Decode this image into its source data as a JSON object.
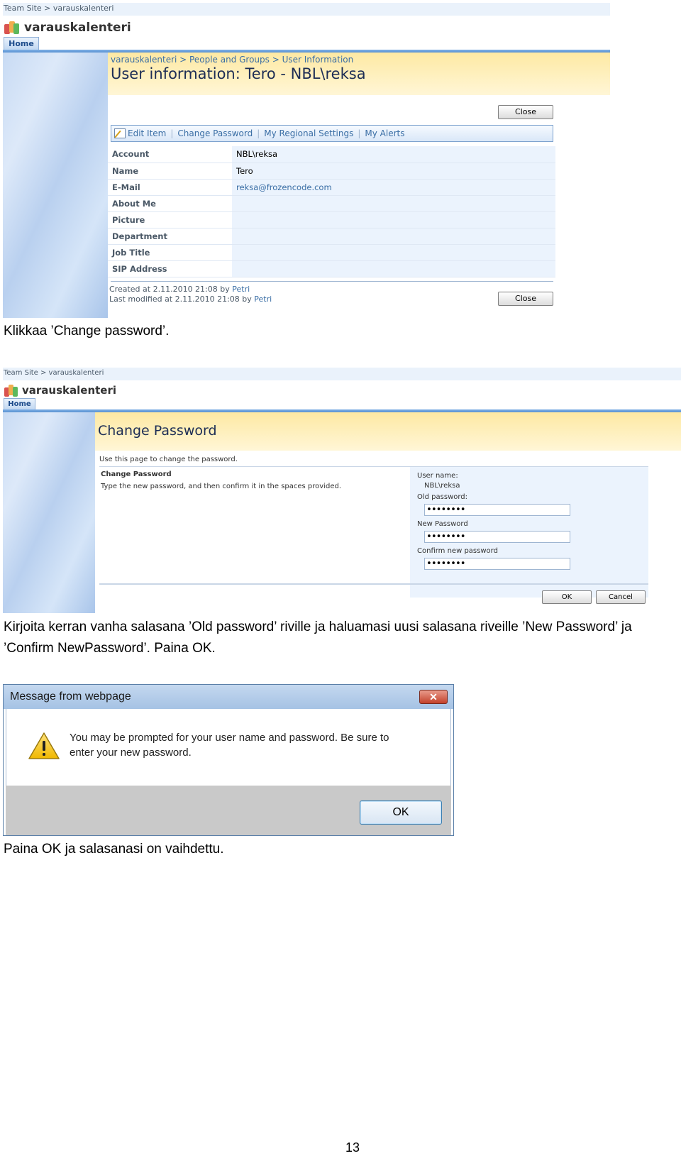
{
  "screenshot1": {
    "topbar": "Team Site > varauskalenteri",
    "site_title": "varauskalenteri",
    "home_tab": "Home",
    "breadcrumb": "varauskalenteri > People and Groups > User Information",
    "page_title": "User information: Tero - NBL\\reksa",
    "close_label": "Close",
    "toolbar": {
      "edit_item": "Edit Item",
      "change_password": "Change Password",
      "regional_settings": "My Regional Settings",
      "my_alerts": "My Alerts"
    },
    "fields": [
      {
        "label": "Account",
        "value": "NBL\\reksa"
      },
      {
        "label": "Name",
        "value": "Tero"
      },
      {
        "label": "E-Mail",
        "value": "reksa@frozencode.com"
      },
      {
        "label": "About Me",
        "value": ""
      },
      {
        "label": "Picture",
        "value": ""
      },
      {
        "label": "Department",
        "value": ""
      },
      {
        "label": "Job Title",
        "value": ""
      },
      {
        "label": "SIP Address",
        "value": ""
      }
    ],
    "created_prefix": "Created at 2.11.2010 21:08  by",
    "created_by": "Petri",
    "modified_prefix": "Last modified at 2.11.2010 21:08  by",
    "modified_by": "Petri"
  },
  "caption1": "Klikkaa ’Change password’.",
  "screenshot2": {
    "topbar": "Team Site > varauskalenteri",
    "site_title": "varauskalenteri",
    "home_tab": "Home",
    "page_title": "Change Password",
    "intro": "Use this page to change the password.",
    "section_title": "Change Password",
    "section_desc": "Type the new password, and then confirm it in the spaces provided.",
    "username_label": "User name:",
    "username_value": "NBL\\reksa",
    "old_label": "Old password:",
    "old_value": "••••••••",
    "new_label": "New Password",
    "new_value": "••••••••",
    "confirm_label": "Confirm new password",
    "confirm_value": "••••••••",
    "ok_label": "OK",
    "cancel_label": "Cancel"
  },
  "caption2_line1": "Kirjoita kerran vanha salasana ’Old password’ riville ja haluamasi uusi salasana riveille ’New Password’ ja",
  "caption2_line2": "’Confirm NewPassword’. Paina OK.",
  "dialog": {
    "title": "Message from webpage",
    "close_glyph": "✕",
    "message_line1": "You may be prompted for your user name and password.  Be sure to",
    "message_line2": "enter your new password.",
    "ok_label": "OK"
  },
  "caption3": "Paina OK ja salasanasi on vaihdettu.",
  "page_number": "13"
}
